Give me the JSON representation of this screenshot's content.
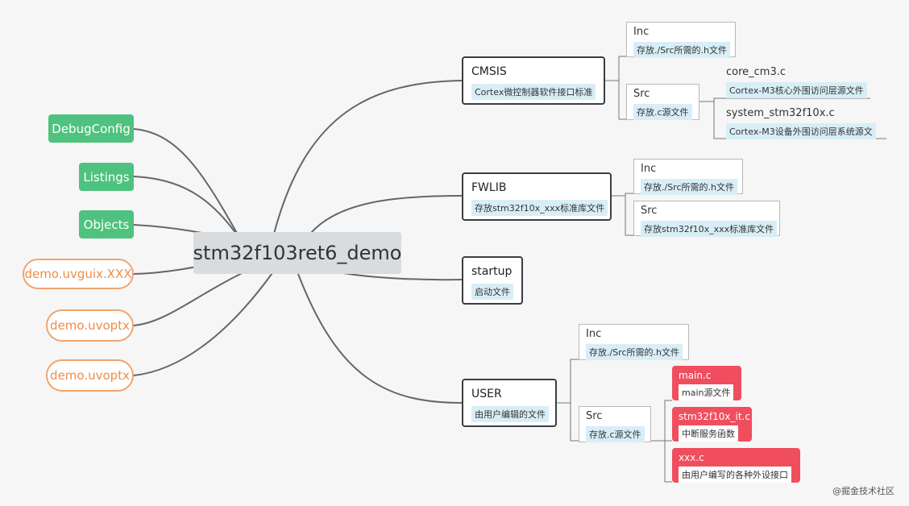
{
  "root": "stm32f103ret6_demo",
  "left": {
    "green": [
      "DebugConfig",
      "Listings",
      "Objects"
    ],
    "orange": [
      "demo.uvguix.XXX",
      "demo.uvoptx",
      "demo.uvoptx"
    ]
  },
  "cmsis": {
    "title": "CMSIS",
    "note": "Cortex微控制器软件接口标准",
    "inc": {
      "title": "Inc",
      "note": "存放./Src所需的.h文件"
    },
    "src": {
      "title": "Src",
      "note": "存放.c源文件"
    },
    "core": {
      "title": "core_cm3.c",
      "note": "Cortex-M3核心外围访问层源文件"
    },
    "system": {
      "title": "system_stm32f10x.c",
      "note": "Cortex-M3设备外围访问层系统源文"
    }
  },
  "fwlib": {
    "title": "FWLIB",
    "note": "存放stm32f10x_xxx标准库文件",
    "inc": {
      "title": "Inc",
      "note": "存放./Src所需的.h文件"
    },
    "src": {
      "title": "Src",
      "note": "存放stm32f10x_xxx标准库文件"
    }
  },
  "startup": {
    "title": "startup",
    "note": "启动文件"
  },
  "user": {
    "title": "USER",
    "note": "由用户编辑的文件",
    "inc": {
      "title": "Inc",
      "note": "存放./Src所需的.h文件"
    },
    "src": {
      "title": "Src",
      "note": "存放.c源文件"
    },
    "main": {
      "title": "main.c",
      "note": "main源文件"
    },
    "it": {
      "title": "stm32f10x_it.c",
      "note": "中断服务函数"
    },
    "xxx": {
      "title": "xxx.c",
      "note": "由用户编写的各种外设接口"
    }
  },
  "watermark": "@掘金技术社区",
  "colors": {
    "green": "#4ec27e",
    "orange": "#ee8d4a",
    "red": "#f04e5e",
    "note_bg": "#d8eef7",
    "root_bg": "#d9dcde",
    "line": "#666666"
  }
}
